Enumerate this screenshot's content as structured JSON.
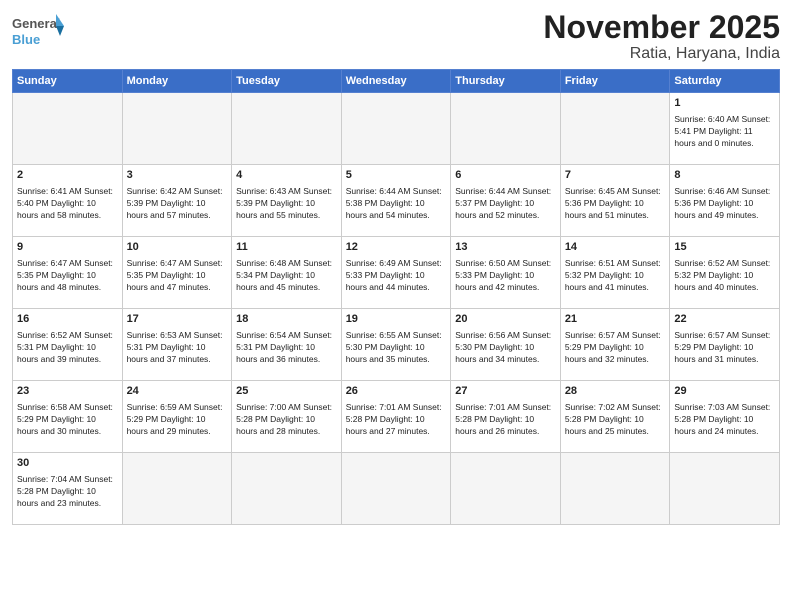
{
  "logo": {
    "text_general": "General",
    "text_blue": "Blue"
  },
  "header": {
    "month": "November 2025",
    "location": "Ratia, Haryana, India"
  },
  "weekdays": [
    "Sunday",
    "Monday",
    "Tuesday",
    "Wednesday",
    "Thursday",
    "Friday",
    "Saturday"
  ],
  "weeks": [
    [
      {
        "day": "",
        "info": ""
      },
      {
        "day": "",
        "info": ""
      },
      {
        "day": "",
        "info": ""
      },
      {
        "day": "",
        "info": ""
      },
      {
        "day": "",
        "info": ""
      },
      {
        "day": "",
        "info": ""
      },
      {
        "day": "1",
        "info": "Sunrise: 6:40 AM\nSunset: 5:41 PM\nDaylight: 11 hours\nand 0 minutes."
      }
    ],
    [
      {
        "day": "2",
        "info": "Sunrise: 6:41 AM\nSunset: 5:40 PM\nDaylight: 10 hours\nand 58 minutes."
      },
      {
        "day": "3",
        "info": "Sunrise: 6:42 AM\nSunset: 5:39 PM\nDaylight: 10 hours\nand 57 minutes."
      },
      {
        "day": "4",
        "info": "Sunrise: 6:43 AM\nSunset: 5:39 PM\nDaylight: 10 hours\nand 55 minutes."
      },
      {
        "day": "5",
        "info": "Sunrise: 6:44 AM\nSunset: 5:38 PM\nDaylight: 10 hours\nand 54 minutes."
      },
      {
        "day": "6",
        "info": "Sunrise: 6:44 AM\nSunset: 5:37 PM\nDaylight: 10 hours\nand 52 minutes."
      },
      {
        "day": "7",
        "info": "Sunrise: 6:45 AM\nSunset: 5:36 PM\nDaylight: 10 hours\nand 51 minutes."
      },
      {
        "day": "8",
        "info": "Sunrise: 6:46 AM\nSunset: 5:36 PM\nDaylight: 10 hours\nand 49 minutes."
      }
    ],
    [
      {
        "day": "9",
        "info": "Sunrise: 6:47 AM\nSunset: 5:35 PM\nDaylight: 10 hours\nand 48 minutes."
      },
      {
        "day": "10",
        "info": "Sunrise: 6:47 AM\nSunset: 5:35 PM\nDaylight: 10 hours\nand 47 minutes."
      },
      {
        "day": "11",
        "info": "Sunrise: 6:48 AM\nSunset: 5:34 PM\nDaylight: 10 hours\nand 45 minutes."
      },
      {
        "day": "12",
        "info": "Sunrise: 6:49 AM\nSunset: 5:33 PM\nDaylight: 10 hours\nand 44 minutes."
      },
      {
        "day": "13",
        "info": "Sunrise: 6:50 AM\nSunset: 5:33 PM\nDaylight: 10 hours\nand 42 minutes."
      },
      {
        "day": "14",
        "info": "Sunrise: 6:51 AM\nSunset: 5:32 PM\nDaylight: 10 hours\nand 41 minutes."
      },
      {
        "day": "15",
        "info": "Sunrise: 6:52 AM\nSunset: 5:32 PM\nDaylight: 10 hours\nand 40 minutes."
      }
    ],
    [
      {
        "day": "16",
        "info": "Sunrise: 6:52 AM\nSunset: 5:31 PM\nDaylight: 10 hours\nand 39 minutes."
      },
      {
        "day": "17",
        "info": "Sunrise: 6:53 AM\nSunset: 5:31 PM\nDaylight: 10 hours\nand 37 minutes."
      },
      {
        "day": "18",
        "info": "Sunrise: 6:54 AM\nSunset: 5:31 PM\nDaylight: 10 hours\nand 36 minutes."
      },
      {
        "day": "19",
        "info": "Sunrise: 6:55 AM\nSunset: 5:30 PM\nDaylight: 10 hours\nand 35 minutes."
      },
      {
        "day": "20",
        "info": "Sunrise: 6:56 AM\nSunset: 5:30 PM\nDaylight: 10 hours\nand 34 minutes."
      },
      {
        "day": "21",
        "info": "Sunrise: 6:57 AM\nSunset: 5:29 PM\nDaylight: 10 hours\nand 32 minutes."
      },
      {
        "day": "22",
        "info": "Sunrise: 6:57 AM\nSunset: 5:29 PM\nDaylight: 10 hours\nand 31 minutes."
      }
    ],
    [
      {
        "day": "23",
        "info": "Sunrise: 6:58 AM\nSunset: 5:29 PM\nDaylight: 10 hours\nand 30 minutes."
      },
      {
        "day": "24",
        "info": "Sunrise: 6:59 AM\nSunset: 5:29 PM\nDaylight: 10 hours\nand 29 minutes."
      },
      {
        "day": "25",
        "info": "Sunrise: 7:00 AM\nSunset: 5:28 PM\nDaylight: 10 hours\nand 28 minutes."
      },
      {
        "day": "26",
        "info": "Sunrise: 7:01 AM\nSunset: 5:28 PM\nDaylight: 10 hours\nand 27 minutes."
      },
      {
        "day": "27",
        "info": "Sunrise: 7:01 AM\nSunset: 5:28 PM\nDaylight: 10 hours\nand 26 minutes."
      },
      {
        "day": "28",
        "info": "Sunrise: 7:02 AM\nSunset: 5:28 PM\nDaylight: 10 hours\nand 25 minutes."
      },
      {
        "day": "29",
        "info": "Sunrise: 7:03 AM\nSunset: 5:28 PM\nDaylight: 10 hours\nand 24 minutes."
      }
    ],
    [
      {
        "day": "30",
        "info": "Sunrise: 7:04 AM\nSunset: 5:28 PM\nDaylight: 10 hours\nand 23 minutes."
      },
      {
        "day": "",
        "info": ""
      },
      {
        "day": "",
        "info": ""
      },
      {
        "day": "",
        "info": ""
      },
      {
        "day": "",
        "info": ""
      },
      {
        "day": "",
        "info": ""
      },
      {
        "day": "",
        "info": ""
      }
    ]
  ]
}
